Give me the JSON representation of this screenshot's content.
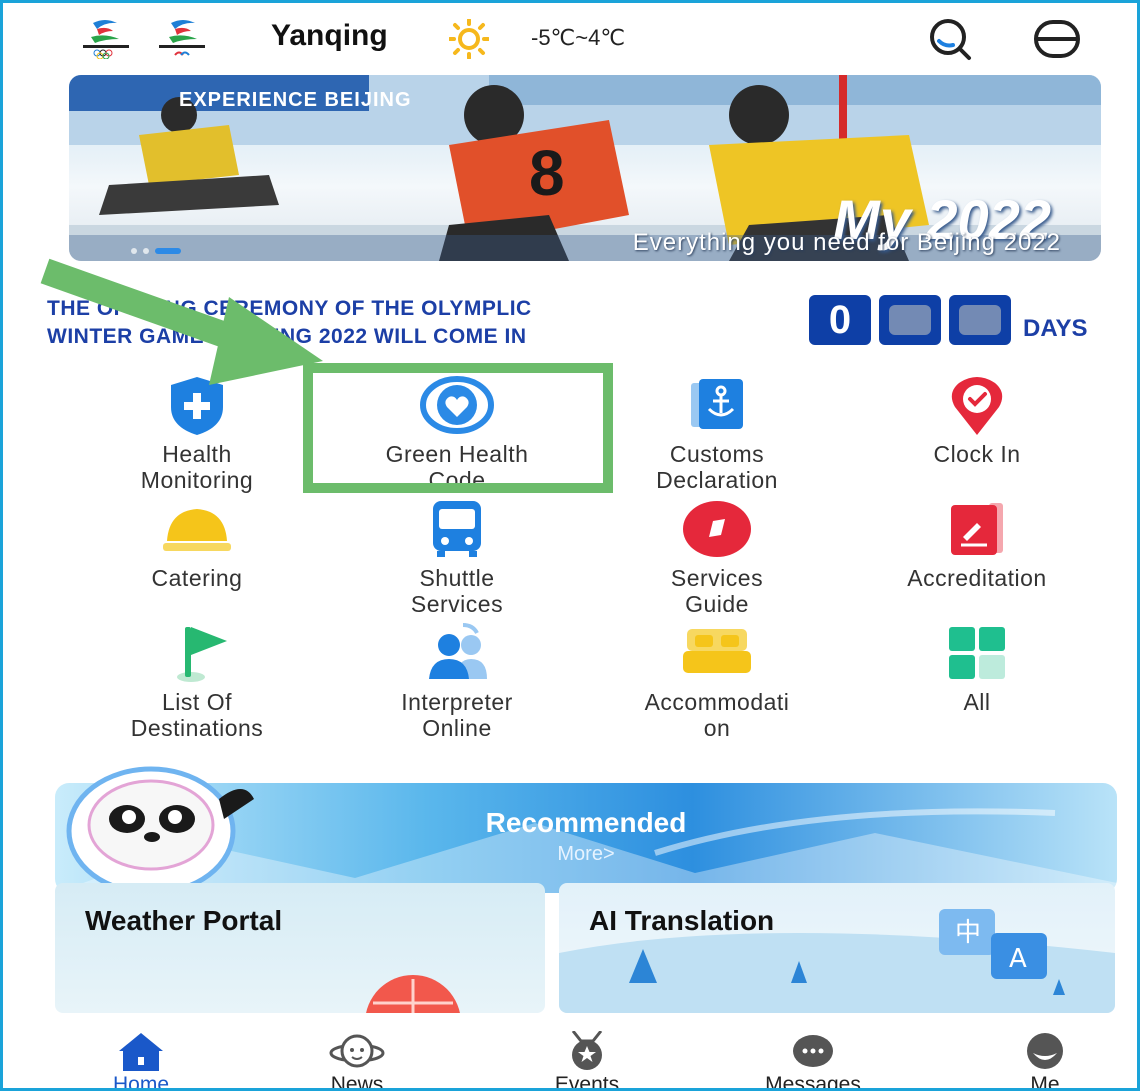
{
  "header": {
    "city": "Yanqing",
    "temperature": "-5℃~4℃",
    "weather_icon": "sun-icon"
  },
  "banner": {
    "tag": "EXPERIENCE BEIJING",
    "headline": "My 2022",
    "subtitle": "Everything you need for Beijing 2022"
  },
  "countdown": {
    "line1": "THE OPENING CEREMONY OF THE OLYMPLIC",
    "line2": "WINTER GAMES BEIJING 2022 WILL COME IN",
    "digit1": "0",
    "days_label": "DAYS"
  },
  "services": [
    {
      "label_line1": "Health",
      "label_line2": "Monitoring",
      "icon": "shield-plus-icon",
      "color": "#1e80e0"
    },
    {
      "label_line1": "Green Health",
      "label_line2": "Code",
      "icon": "heart-globe-icon",
      "color": "#2b8ae6"
    },
    {
      "label_line1": "Customs",
      "label_line2": "Declaration",
      "icon": "anchor-document-icon",
      "color": "#1e80e0"
    },
    {
      "label_line1": "Clock In",
      "label_line2": "",
      "icon": "check-pin-icon",
      "color": "#e5283b"
    },
    {
      "label_line1": "Catering",
      "label_line2": "",
      "icon": "cloche-icon",
      "color": "#f5c51a"
    },
    {
      "label_line1": "Shuttle",
      "label_line2": "Services",
      "icon": "bus-icon",
      "color": "#1e80e0"
    },
    {
      "label_line1": "Services",
      "label_line2": "Guide",
      "icon": "compass-icon",
      "color": "#e5283b"
    },
    {
      "label_line1": "Accreditation",
      "label_line2": "",
      "icon": "id-card-icon",
      "color": "#e5283b"
    },
    {
      "label_line1": "List Of",
      "label_line2": "Destinations",
      "icon": "flag-icon",
      "color": "#27b871"
    },
    {
      "label_line1": "Interpreter",
      "label_line2": "Online",
      "icon": "people-icon",
      "color": "#1e80e0"
    },
    {
      "label_line1": "Accommodati",
      "label_line2": "on",
      "icon": "bed-icon",
      "color": "#f5c51a"
    },
    {
      "label_line1": "All",
      "label_line2": "",
      "icon": "grid-icon",
      "color": "#1fbf8f"
    }
  ],
  "recommended": {
    "title": "Recommended",
    "more": "More>"
  },
  "cards": {
    "weather": "Weather Portal",
    "translation": "AI Translation"
  },
  "nav": [
    {
      "label": "Home",
      "icon": "home-icon"
    },
    {
      "label": "News",
      "icon": "planet-icon"
    },
    {
      "label": "Events",
      "icon": "medal-icon"
    },
    {
      "label": "Messages",
      "icon": "chat-bubble-icon"
    },
    {
      "label": "Me",
      "icon": "profile-icon"
    }
  ],
  "colors": {
    "accent_blue": "#1c3fa6",
    "highlight_green": "#6cbc6b",
    "active_nav": "#1a58c9"
  }
}
